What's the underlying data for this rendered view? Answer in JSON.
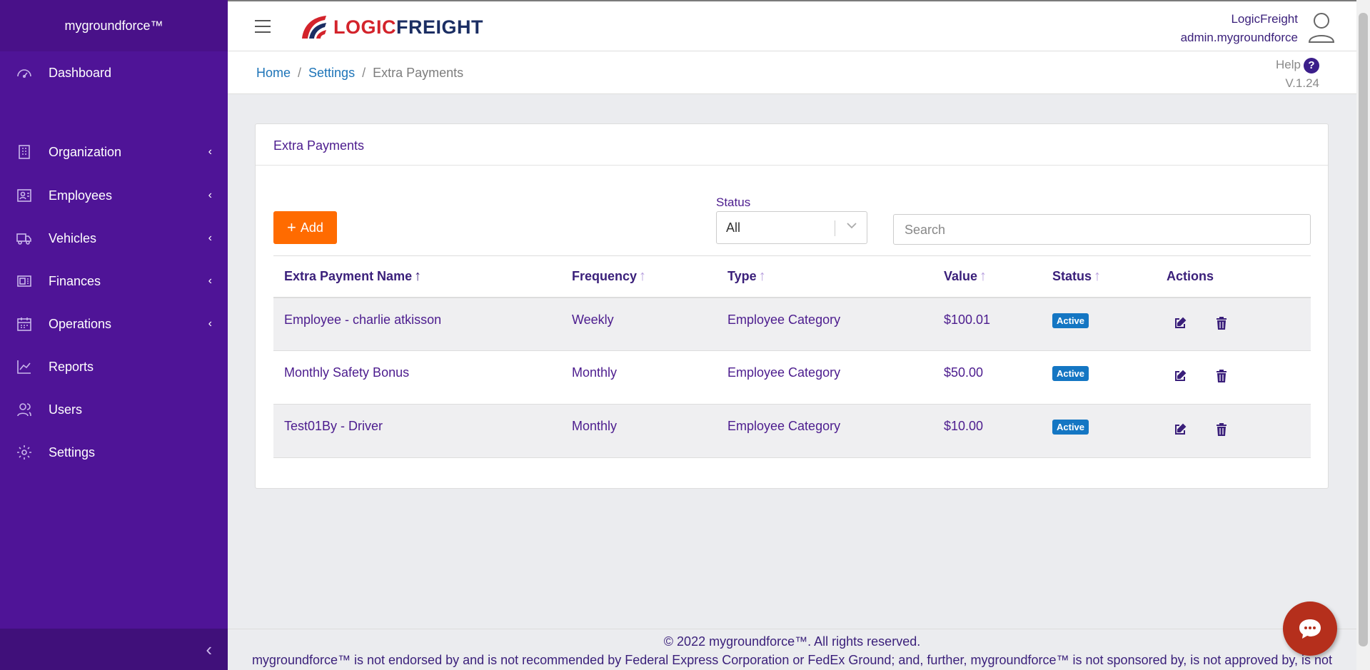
{
  "sidebar": {
    "brand": "mygroundforce™",
    "items": [
      {
        "label": "Dashboard",
        "icon": "dashboard-icon"
      },
      {
        "label": "Organization",
        "icon": "building-icon"
      },
      {
        "label": "Employees",
        "icon": "employee-card-icon"
      },
      {
        "label": "Vehicles",
        "icon": "truck-icon"
      },
      {
        "label": "Finances",
        "icon": "money-icon"
      },
      {
        "label": "Operations",
        "icon": "calendar-icon"
      },
      {
        "label": "Reports",
        "icon": "chart-icon"
      },
      {
        "label": "Users",
        "icon": "users-icon"
      },
      {
        "label": "Settings",
        "icon": "gear-icon"
      }
    ],
    "collapse_icon": "chevron-left-icon"
  },
  "header": {
    "logo_part1": "LOGIC",
    "logo_part2": "FREIGHT",
    "company": "LogicFreight",
    "username": "admin.mygroundforce"
  },
  "breadcrumb": {
    "home": "Home",
    "settings": "Settings",
    "current": "Extra Payments"
  },
  "help": {
    "label": "Help",
    "icon": "?",
    "version": "V.1.24"
  },
  "card": {
    "title": "Extra Payments",
    "add_label": "Add",
    "status_label": "Status",
    "status_value": "All",
    "search_placeholder": "Search"
  },
  "table": {
    "headers": [
      "Extra Payment Name",
      "Frequency",
      "Type",
      "Value",
      "Status",
      "Actions"
    ],
    "rows": [
      {
        "name": "Employee - charlie atkisson",
        "frequency": "Weekly",
        "type": "Employee Category",
        "value": "$100.01",
        "status": "Active"
      },
      {
        "name": "Monthly Safety Bonus",
        "frequency": "Monthly",
        "type": "Employee Category",
        "value": "$50.00",
        "status": "Active"
      },
      {
        "name": "Test01By - Driver",
        "frequency": "Monthly",
        "type": "Employee Category",
        "value": "$10.00",
        "status": "Active"
      }
    ]
  },
  "footer": {
    "copyright": "© 2022 mygroundforce™. All rights reserved.",
    "disclaimer": "mygroundforce™ is not endorsed by and is not recommended by Federal Express Corporation or FedEx Ground; and, further, mygroundforce™ is not sponsored by, is not approved by, is not"
  },
  "colors": {
    "sidebar": "#4f1497",
    "accent": "#ff6b00",
    "badge": "#1476c3",
    "link": "#1d74b8"
  }
}
